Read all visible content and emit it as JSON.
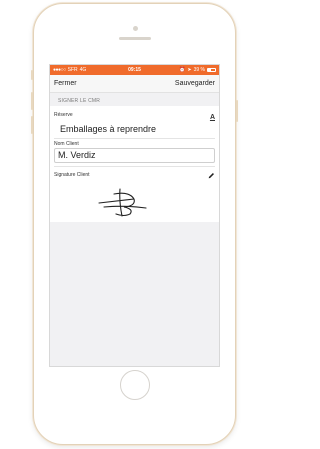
{
  "status_bar": {
    "carrier": "SFR",
    "network": "4G",
    "time": "09:15",
    "battery_text": "39 %",
    "battery_level": 0.39,
    "color": "#f06b2b"
  },
  "nav": {
    "close_label": "Fermer",
    "save_label": "Sauvegarder"
  },
  "section": {
    "title": "SIGNER LE CMR"
  },
  "reserve": {
    "label": "Réserve",
    "value": "Emballages à reprendre",
    "icon": "text-format-icon"
  },
  "client_name": {
    "label": "Nom Client",
    "value": "M. Verdiz"
  },
  "signature": {
    "label": "Signature Client",
    "icon": "pencil-icon"
  }
}
